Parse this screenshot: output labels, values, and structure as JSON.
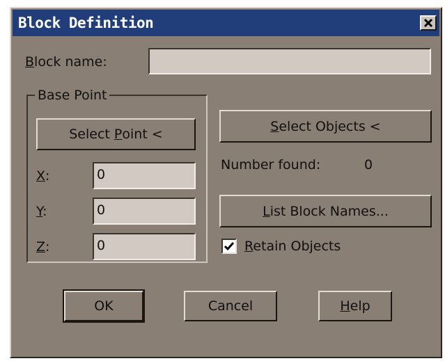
{
  "window": {
    "title": "Block Definition",
    "close_glyph": "✕"
  },
  "block_name": {
    "label_hotkey": "B",
    "label_rest": "lock name:",
    "value": ""
  },
  "base_point": {
    "group_label": "Base Point",
    "select_point_pre": "Select ",
    "select_point_hotkey": "P",
    "select_point_post": "oint <",
    "x_label_hotkey": "X",
    "x_label_rest": ":",
    "x_value": "0",
    "y_label_hotkey": "Y",
    "y_label_rest": ":",
    "y_value": "0",
    "z_label_hotkey": "Z",
    "z_label_rest": ":",
    "z_value": "0"
  },
  "objects": {
    "select_objects_hotkey": "S",
    "select_objects_rest": "elect Objects <",
    "number_found_label": "Number found:",
    "number_found_value": "0",
    "list_names_hotkey": "L",
    "list_names_rest": "ist Block Names...",
    "retain_hotkey": "R",
    "retain_rest": "etain Objects",
    "retain_checked": true
  },
  "buttons": {
    "ok": "OK",
    "cancel": "Cancel",
    "help_hotkey": "H",
    "help_rest": "elp"
  }
}
